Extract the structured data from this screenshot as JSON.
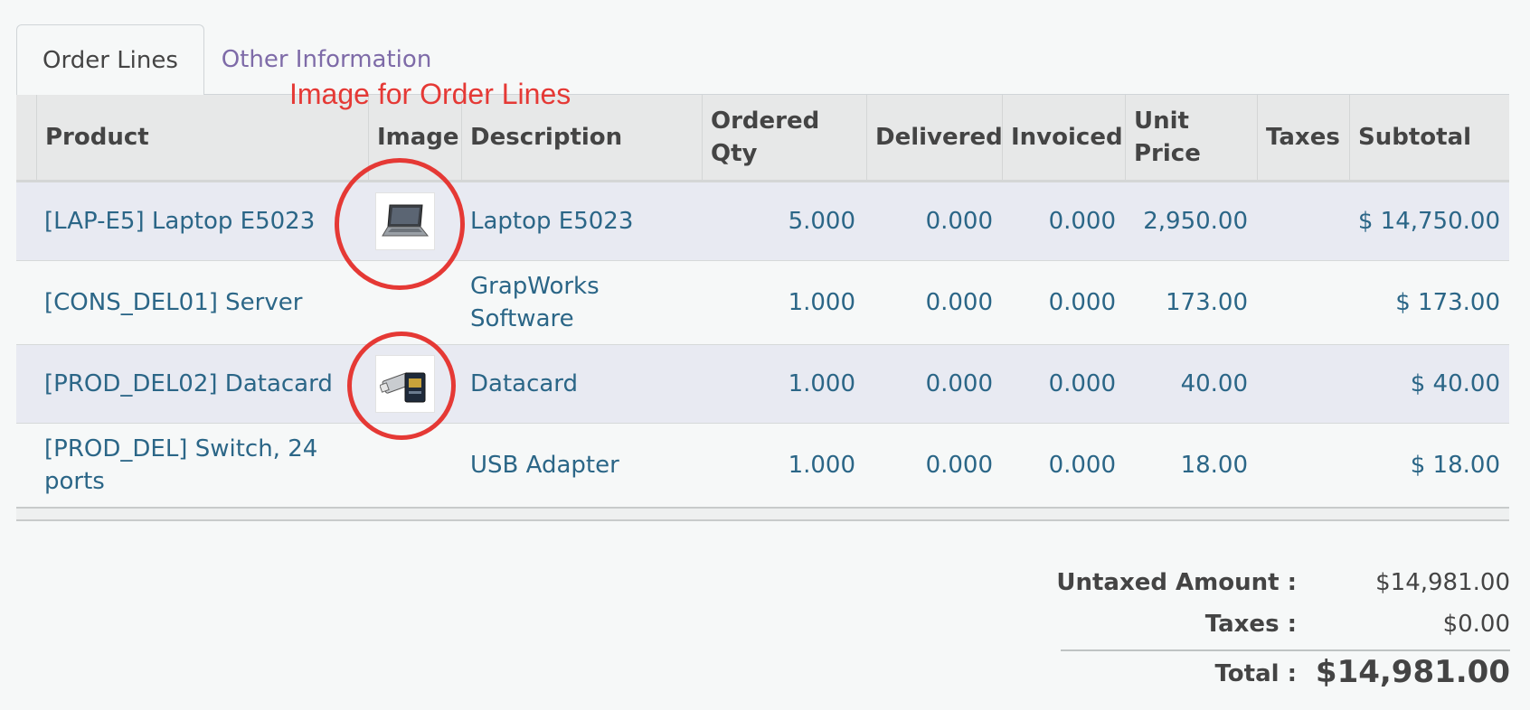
{
  "tabs": [
    {
      "label": "Order Lines"
    },
    {
      "label": "Other Information"
    }
  ],
  "annotation": "Image for Order Lines",
  "columns": {
    "product": "Product",
    "image": "Image",
    "description": "Description",
    "ordered_qty": "Ordered Qty",
    "delivered": "Delivered",
    "invoiced": "Invoiced",
    "unit_price": "Unit Price",
    "taxes": "Taxes",
    "subtotal": "Subtotal"
  },
  "rows": [
    {
      "product": "[LAP-E5] Laptop E5023",
      "image": "laptop",
      "description": "Laptop E5023",
      "ordered_qty": "5.000",
      "delivered": "0.000",
      "invoiced": "0.000",
      "unit_price": "2,950.00",
      "taxes": "",
      "subtotal": "$ 14,750.00"
    },
    {
      "product": "[CONS_DEL01] Server",
      "image": "",
      "description": "GrapWorks Software",
      "ordered_qty": "1.000",
      "delivered": "0.000",
      "invoiced": "0.000",
      "unit_price": "173.00",
      "taxes": "",
      "subtotal": "$ 173.00"
    },
    {
      "product": "[PROD_DEL02] Datacard",
      "image": "datacard",
      "description": "Datacard",
      "ordered_qty": "1.000",
      "delivered": "0.000",
      "invoiced": "0.000",
      "unit_price": "40.00",
      "taxes": "",
      "subtotal": "$ 40.00"
    },
    {
      "product": "[PROD_DEL] Switch, 24 ports",
      "image": "",
      "description": "USB Adapter",
      "ordered_qty": "1.000",
      "delivered": "0.000",
      "invoiced": "0.000",
      "unit_price": "18.00",
      "taxes": "",
      "subtotal": "$ 18.00"
    }
  ],
  "totals": {
    "untaxed_label": "Untaxed Amount :",
    "untaxed_value": "$14,981.00",
    "taxes_label": "Taxes :",
    "taxes_value": "$0.00",
    "total_label": "Total :",
    "total_value": "$14,981.00"
  },
  "colors": {
    "link": "#2b6687",
    "tab_other": "#7e6ba8",
    "annotation": "#e53935",
    "row_shade": "#e8eaf2"
  }
}
